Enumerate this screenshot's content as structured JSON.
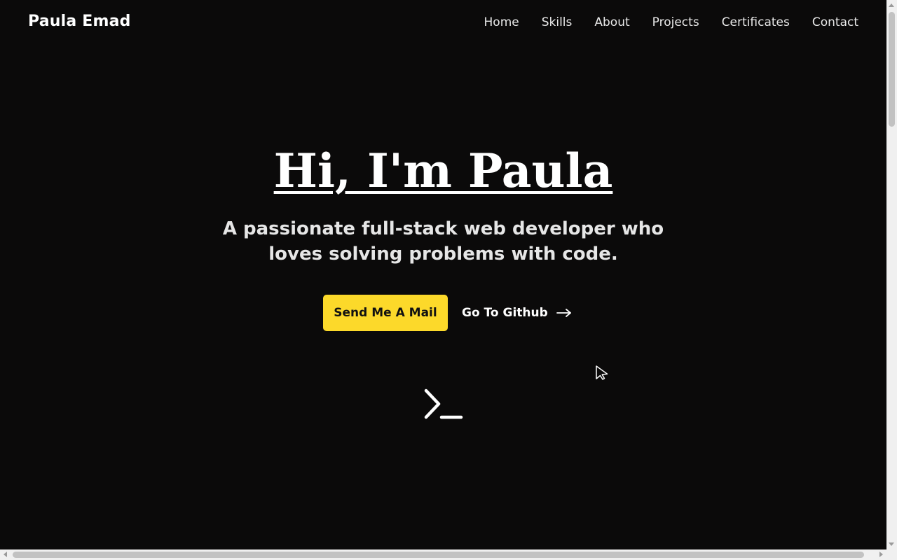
{
  "header": {
    "brand": "Paula Emad",
    "nav": [
      {
        "label": "Home"
      },
      {
        "label": "Skills"
      },
      {
        "label": "About"
      },
      {
        "label": "Projects"
      },
      {
        "label": "Certificates"
      },
      {
        "label": "Contact"
      }
    ]
  },
  "hero": {
    "title": "Hi, I'm Paula",
    "subtitle": "A passionate full-stack web developer who loves solving problems with code.",
    "primary_button": "Send Me A Mail",
    "secondary_link": "Go To Github",
    "secondary_icon": "arrow-right-icon",
    "emblem_icon": "terminal-icon"
  },
  "colors": {
    "background": "#0b0a0a",
    "accent": "#fcd92a",
    "text": "#ffffff"
  }
}
